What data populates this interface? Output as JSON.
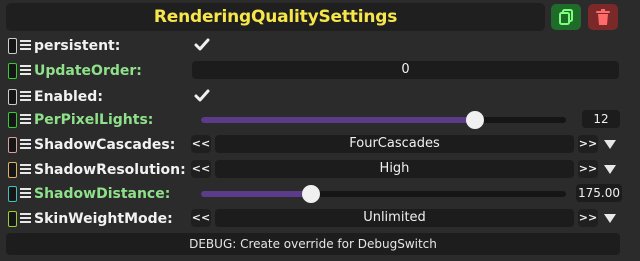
{
  "header": {
    "title": "RenderingQualitySettings",
    "copy_icon": "copy-icon",
    "delete_icon": "trash-icon",
    "copy_color": "#1e6b2a",
    "delete_color": "#7a2828",
    "title_color": "#f7e64a"
  },
  "rows": [
    {
      "label": "persistent:",
      "type": "checkbox",
      "checked": true,
      "indicator_color": "#cccccc"
    },
    {
      "label": "UpdateOrder:",
      "type": "number",
      "value": "0",
      "indicator_color": "#33cc33"
    },
    {
      "label": "Enabled:",
      "type": "checkbox",
      "checked": true,
      "indicator_color": "#cccccc"
    },
    {
      "label": "PerPixelLights:",
      "type": "slider",
      "value": "12",
      "fraction": 0.75,
      "indicator_color": "#33cc33"
    },
    {
      "label": "ShadowCascades:",
      "type": "enum",
      "value": "FourCascades",
      "prev": "<<",
      "next": ">>",
      "indicator_color": "#d9a0a0"
    },
    {
      "label": "ShadowResolution:",
      "type": "enum",
      "value": "High",
      "prev": "<<",
      "next": ">>",
      "indicator_color": "#e0b060"
    },
    {
      "label": "ShadowDistance:",
      "type": "slider",
      "value": "175.00",
      "fraction": 0.3,
      "indicator_color": "#40c0c0"
    },
    {
      "label": "SkinWeightMode:",
      "type": "enum",
      "value": "Unlimited",
      "prev": "<<",
      "next": ">>",
      "indicator_color": "#9acd32"
    }
  ],
  "footer": {
    "label": "DEBUG: Create override for DebugSwitch"
  }
}
